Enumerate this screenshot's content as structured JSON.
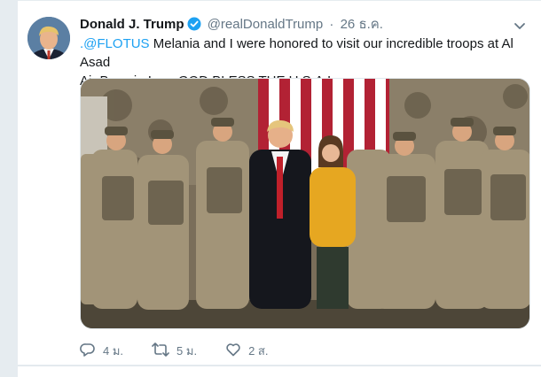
{
  "tweet": {
    "author_name": "Donald J. Trump",
    "author_handle": "@realDonaldTrump",
    "separator": "·",
    "timestamp": "26 ธ.ค.",
    "mention": ".@FLOTUS",
    "text_line1": " Melania and I were honored to visit our incredible troops at Al Asad",
    "text_line2": "Air Base in Iraq. GOD BLESS THE U.S.A.!"
  },
  "actions": {
    "reply_count": "4 ม.",
    "retweet_count": "5 ม.",
    "like_count": "2 ส."
  },
  "icons": {
    "verified": "verified-badge-icon",
    "caret": "chevron-down-icon",
    "reply": "reply-icon",
    "retweet": "retweet-icon",
    "like": "heart-icon"
  },
  "colors": {
    "accent": "#1da1f2",
    "text": "#14171a",
    "muted": "#657786",
    "page_bg": "#e6ecf0"
  }
}
